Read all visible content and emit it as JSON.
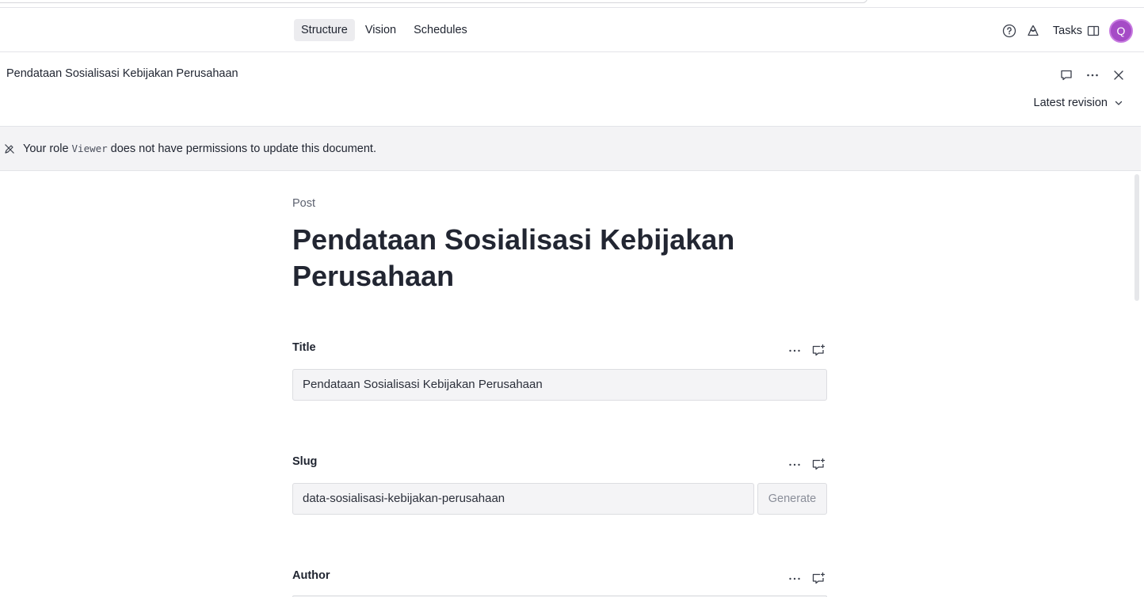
{
  "nav": {
    "tabs": [
      {
        "label": "Structure",
        "active": true
      },
      {
        "label": "Vision",
        "active": false
      },
      {
        "label": "Schedules",
        "active": false
      }
    ],
    "tasks_label": "Tasks",
    "avatar_initial": "Q"
  },
  "document": {
    "header_title": "Pendataan Sosialisasi Kebijakan Perusahaan",
    "revision_label": "Latest revision",
    "type_label": "Post",
    "heading": "Pendataan Sosialisasi Kebijakan Perusahaan"
  },
  "banner": {
    "prefix": "Your role",
    "role": "Viewer",
    "suffix": "does not have permissions to update this document."
  },
  "fields": {
    "title": {
      "label": "Title",
      "value": "Pendataan Sosialisasi Kebijakan Perusahaan"
    },
    "slug": {
      "label": "Slug",
      "value": "data-sosialisasi-kebijakan-perusahaan",
      "button": "Generate"
    },
    "author": {
      "label": "Author"
    }
  },
  "colors": {
    "accent_avatar": "#a54bc6",
    "banner_bg": "#f3f3f5",
    "active_tab_bg": "#ececef"
  }
}
